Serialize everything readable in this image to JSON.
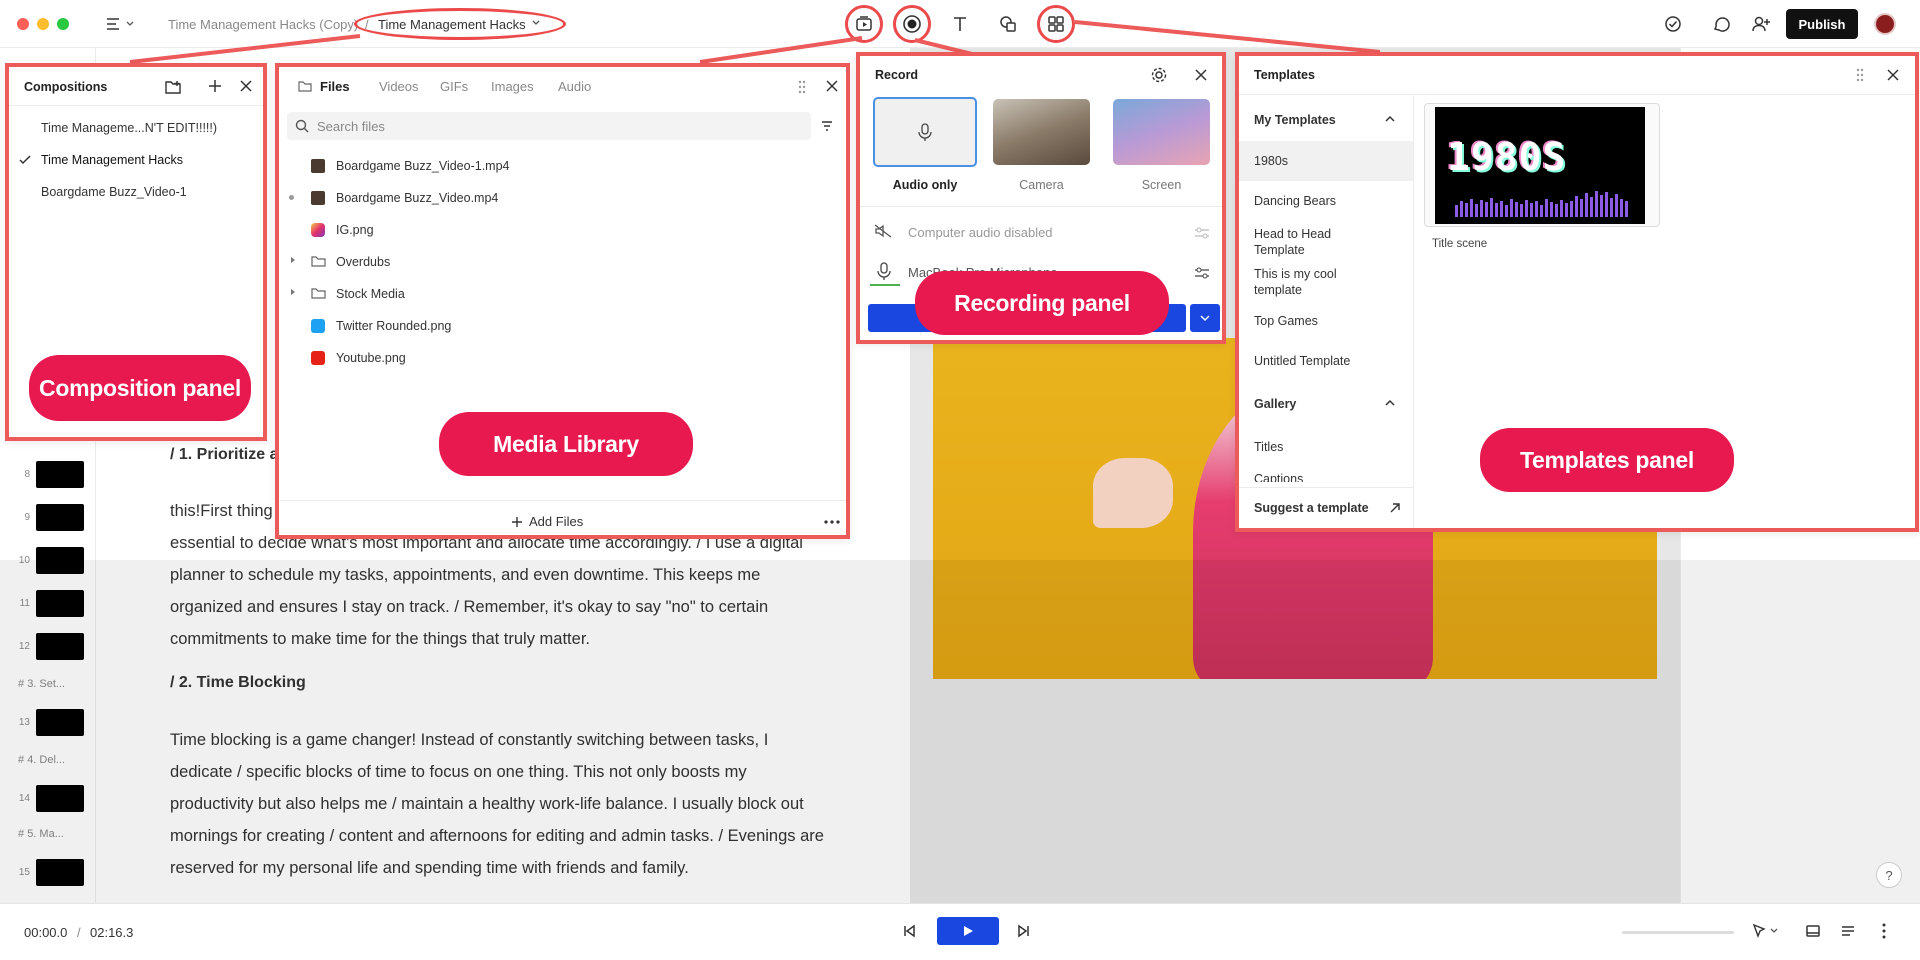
{
  "window": {
    "breadcrumb_parent": "Time Management Hacks (Copy)",
    "breadcrumb_sep": "/",
    "breadcrumb_current": "Time Management Hacks",
    "publish_label": "Publish"
  },
  "composition_panel": {
    "title": "Compositions",
    "items": [
      {
        "label": "Time Manageme...N'T EDIT!!!!!)",
        "checked": false
      },
      {
        "label": "Time Management Hacks",
        "checked": true
      },
      {
        "label": "Boargdame Buzz_Video-1",
        "checked": false
      }
    ],
    "callout": "Composition panel"
  },
  "media_library": {
    "tabs": [
      "Files",
      "Videos",
      "GIFs",
      "Images",
      "Audio"
    ],
    "search_placeholder": "Search files",
    "files": [
      {
        "name": "Boardgame Buzz_Video-1.mp4",
        "type": "video"
      },
      {
        "name": "Boardgame Buzz_Video.mp4",
        "type": "video"
      },
      {
        "name": "IG.png",
        "type": "instagram"
      },
      {
        "name": "Overdubs",
        "type": "folder"
      },
      {
        "name": "Stock Media",
        "type": "folder"
      },
      {
        "name": "Twitter Rounded.png",
        "type": "twitter"
      },
      {
        "name": "Youtube.png",
        "type": "youtube"
      }
    ],
    "add_files_label": "Add Files",
    "callout": "Media Library"
  },
  "record_panel": {
    "title": "Record",
    "options": [
      "Audio only",
      "Camera",
      "Screen"
    ],
    "computer_audio": "Computer audio disabled",
    "microphone": "MacBook Pro Microphone",
    "callout": "Recording panel"
  },
  "templates_panel": {
    "title": "Templates",
    "my_templates_label": "My Templates",
    "my_templates": [
      "1980s",
      "Dancing Bears",
      "Head to Head Template",
      "This is my cool template",
      "Top Games",
      "Untitled Template"
    ],
    "gallery_label": "Gallery",
    "gallery_items": [
      "Titles",
      "Captions"
    ],
    "suggest_label": "Suggest a template",
    "preview_title": "1980S",
    "preview_caption": "Title scene",
    "callout": "Templates panel"
  },
  "script": {
    "heading_partial": "/ 1. Prioritize a",
    "para1": [
      "this!First thing",
      "essential to decide what's most important and allocate time accordingly. / I use a digital",
      "planner to schedule my tasks, appointments, and even downtime. This keeps me",
      "organized and ensures I stay on track. / Remember, it's okay to say \"no\" to certain",
      "commitments to make time for the things that truly matter."
    ],
    "heading2": "/ 2. Time Blocking",
    "para2": [
      "Time blocking is a game changer!  Instead of constantly switching between tasks, I",
      "dedicate / specific blocks of time to focus on one thing. This not only boosts my",
      "productivity but also helps me / maintain a healthy work-life balance. I usually block out",
      "mornings for creating / content and afternoons for editing and admin tasks. / Evenings are",
      "reserved for my personal life and spending time with friends and family."
    ]
  },
  "scene_list": {
    "numbers": [
      "8",
      "9",
      "10",
      "11",
      "12",
      "13",
      "14",
      "15"
    ],
    "sections": [
      "3. Set...",
      "4. Del...",
      "5. Ma..."
    ]
  },
  "transport": {
    "current_time": "00:00.0",
    "sep": "/",
    "total_time": "02:16.3"
  },
  "colors": {
    "accent": "#1a47e0",
    "callout": "#e8194e",
    "highlight": "#ec4a4a",
    "canvas_bg": "#e8b21c"
  }
}
